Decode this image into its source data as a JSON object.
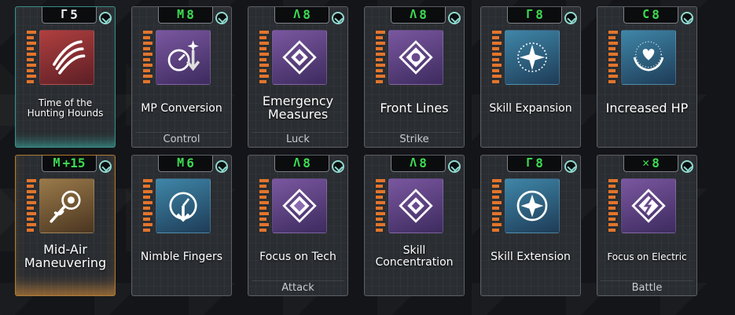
{
  "cards": [
    {
      "title": "Time of the Hunting Hounds",
      "cost_glyph": "Γ",
      "cost": "5",
      "cost_color": "white",
      "category": "",
      "art": "hound-claw-icon",
      "art_color": "red"
    },
    {
      "title": "MP Conversion",
      "cost_glyph": "M",
      "cost": "8",
      "cost_color": "green",
      "category": "Control",
      "art": "gauge-arrow-icon",
      "art_color": "purple"
    },
    {
      "title": "Emergency Measures",
      "cost_glyph": "Λ",
      "cost": "8",
      "cost_color": "green",
      "category": "Luck",
      "art": "diamond-emblem-icon",
      "art_color": "purple"
    },
    {
      "title": "Front Lines",
      "cost_glyph": "Λ",
      "cost": "8",
      "cost_color": "green",
      "category": "Strike",
      "art": "diamond-emblem-icon",
      "art_color": "purple"
    },
    {
      "title": "Skill Expansion",
      "cost_glyph": "Γ",
      "cost": "8",
      "cost_color": "green",
      "category": "",
      "art": "star-burst-icon",
      "art_color": "blue"
    },
    {
      "title": "Increased HP",
      "cost_glyph": "C",
      "cost": "8",
      "cost_color": "green",
      "category": "",
      "art": "heart-hands-icon",
      "art_color": "blue"
    },
    {
      "title": "Mid-Air Maneuvering",
      "cost_glyph": "M",
      "cost": "+15",
      "cost_color": "green",
      "category": "",
      "art": "target-hand-icon",
      "art_color": "amber"
    },
    {
      "title": "Nimble Fingers",
      "cost_glyph": "M",
      "cost": "6",
      "cost_color": "green",
      "category": "",
      "art": "gauge-arrow-icon",
      "art_color": "blue"
    },
    {
      "title": "Focus on Tech",
      "cost_glyph": "Λ",
      "cost": "8",
      "cost_color": "green",
      "category": "Attack",
      "art": "diamond-emblem-icon",
      "art_color": "purple"
    },
    {
      "title": "Skill Concentration",
      "cost_glyph": "Λ",
      "cost": "8",
      "cost_color": "green",
      "category": "",
      "art": "diamond-emblem-icon",
      "art_color": "purple"
    },
    {
      "title": "Skill Extension",
      "cost_glyph": "Γ",
      "cost": "8",
      "cost_color": "green",
      "category": "",
      "art": "compass-star-icon",
      "art_color": "blue"
    },
    {
      "title": "Focus on Electric",
      "cost_glyph": "✕",
      "cost": "8",
      "cost_color": "green",
      "category": "Battle",
      "art": "diamond-emblem-icon",
      "art_color": "purple"
    }
  ],
  "colors": {
    "cost_green": "#3ddc52",
    "accent_teal": "#8fd9cf",
    "bar_orange": "#e2752c"
  }
}
